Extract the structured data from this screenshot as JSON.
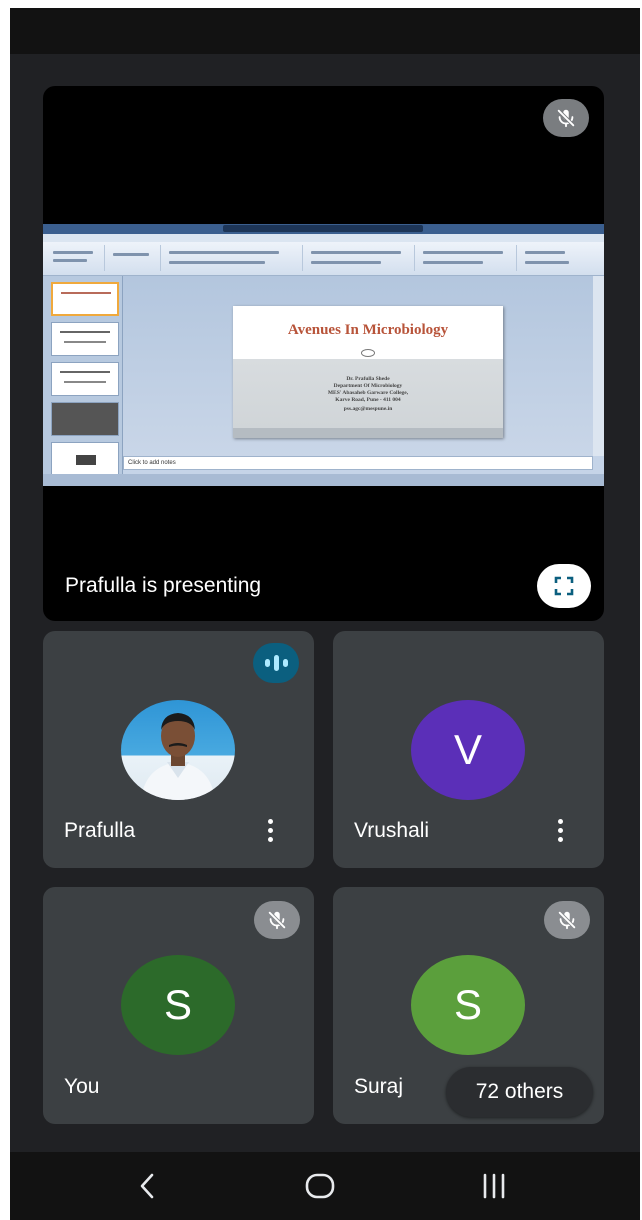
{
  "presentation": {
    "presenting_label": "Prafulla is presenting",
    "slide": {
      "title": "Avenues In Microbiology",
      "lines": [
        "Dr. Prafulla Shede",
        "Department Of Microbiology",
        "MES' Abasaheb Garware College,",
        "Karve Road, Pune - 411 004",
        "pss.agc@mespune.in"
      ],
      "notes_placeholder": "Click to add notes"
    },
    "icons": {
      "mic": "mic-off-icon",
      "fullscreen": "fullscreen-icon"
    }
  },
  "participants": [
    {
      "name": "Prafulla",
      "avatar_type": "photo",
      "status_icon": "speaking-icon",
      "menu_icon": "more-vert-icon"
    },
    {
      "name": "Vrushali",
      "avatar_letter": "V",
      "avatar_color": "#5b2fb8",
      "menu_icon": "more-vert-icon"
    },
    {
      "name": "You",
      "avatar_letter": "S",
      "avatar_color": "#2c6a2a",
      "status_icon": "mic-off-icon"
    },
    {
      "name": "Suraj",
      "avatar_letter": "S",
      "avatar_color": "#5b9f3c",
      "status_icon": "mic-off-icon"
    }
  ],
  "others_badge": "72 others",
  "navigation": {
    "back_icon": "back-icon",
    "home_icon": "home-icon",
    "recents_icon": "recents-icon"
  },
  "colors": {
    "background": "#202124",
    "tile": "#3c4043",
    "speaking": "#0b5f7f"
  }
}
